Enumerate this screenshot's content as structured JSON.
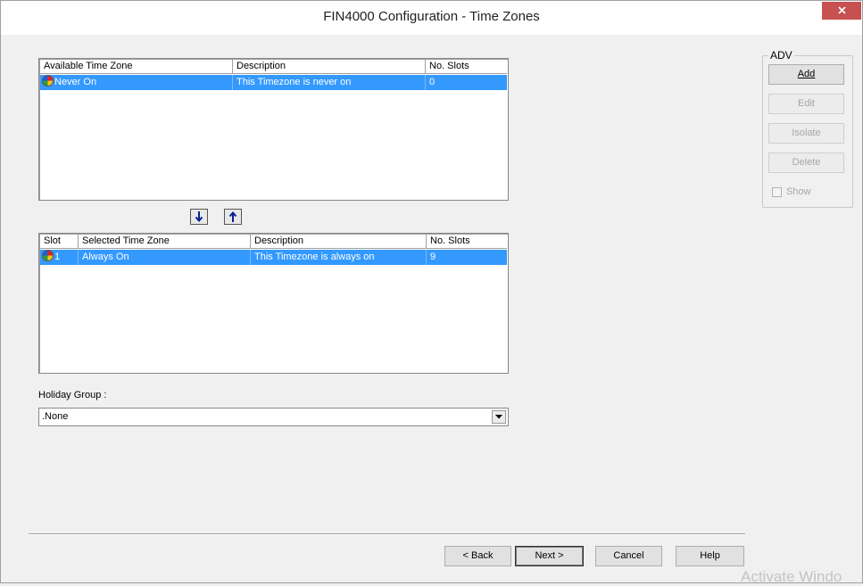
{
  "window": {
    "title": "FIN4000 Configuration - Time Zones",
    "close_glyph": "×"
  },
  "available": {
    "columns": [
      "Available Time Zone",
      "Description",
      "No. Slots"
    ],
    "rows": [
      {
        "name": "Never On",
        "description": "This Timezone is never on",
        "slots": "0"
      }
    ]
  },
  "selected": {
    "columns": [
      "Slot",
      "Selected Time Zone",
      "Description",
      "No. Slots"
    ],
    "rows": [
      {
        "slot": "1",
        "name": "Always On",
        "description": "This Timezone is always on",
        "slots": "9"
      }
    ]
  },
  "move": {
    "down_icon": "arrow-down-icon",
    "up_icon": "arrow-up-icon"
  },
  "holiday": {
    "label": "Holiday Group :",
    "value": ".None"
  },
  "adv": {
    "legend": "ADV",
    "add": "Add",
    "edit": "Edit",
    "isolate": "Isolate",
    "delete": "Delete",
    "show_label": "Show",
    "show_checked": false
  },
  "footer": {
    "back": "< Back",
    "next": "Next >",
    "cancel": "Cancel",
    "help": "Help"
  },
  "watermark": "Activate Windo",
  "colors": {
    "selection": "#3399ff",
    "close_button": "#c75050",
    "background": "#f0f0f0"
  }
}
